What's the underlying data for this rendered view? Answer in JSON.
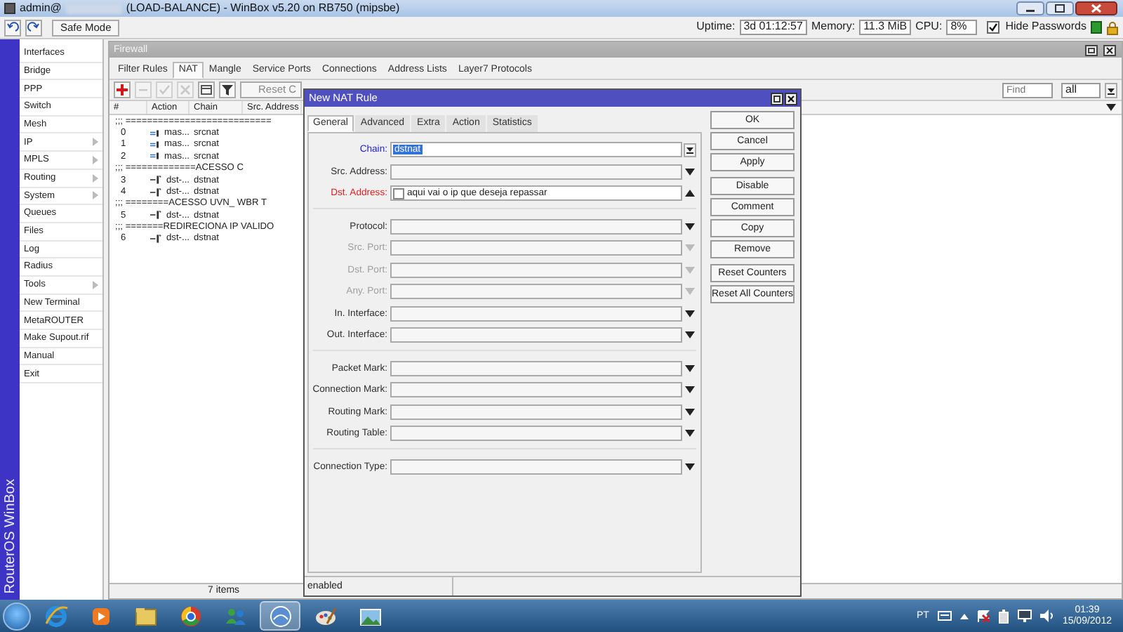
{
  "window": {
    "title_prefix": "admin@",
    "title": "(LOAD-BALANCE) - WinBox v5.20 on RB750 (mipsbe)"
  },
  "toolbar": {
    "safe_mode": {
      "label": "Safe Mode",
      "on": false
    },
    "uptime_label": "Uptime:",
    "uptime": "3d 01:12:57",
    "memory_label": "Memory:",
    "memory": "11.3 MiB",
    "cpu_label": "CPU:",
    "cpu": "8%",
    "hide_passwords": {
      "label": "Hide Passwords",
      "checked": true
    }
  },
  "side_strip": "RouterOS WinBox",
  "sidebar": {
    "items": [
      {
        "label": "Interfaces",
        "submenu": false
      },
      {
        "label": "Bridge",
        "submenu": false
      },
      {
        "label": "PPP",
        "submenu": false
      },
      {
        "label": "Switch",
        "submenu": false
      },
      {
        "label": "Mesh",
        "submenu": false
      },
      {
        "label": "IP",
        "submenu": true
      },
      {
        "label": "MPLS",
        "submenu": true
      },
      {
        "label": "Routing",
        "submenu": true
      },
      {
        "label": "System",
        "submenu": true
      },
      {
        "label": "Queues",
        "submenu": false
      },
      {
        "label": "Files",
        "submenu": false
      },
      {
        "label": "Log",
        "submenu": false
      },
      {
        "label": "Radius",
        "submenu": false
      },
      {
        "label": "Tools",
        "submenu": true
      },
      {
        "label": "New Terminal",
        "submenu": false
      },
      {
        "label": "MetaROUTER",
        "submenu": false
      },
      {
        "label": "Make Supout.rif",
        "submenu": false
      },
      {
        "label": "Manual",
        "submenu": false
      },
      {
        "label": "Exit",
        "submenu": false
      }
    ]
  },
  "firewall": {
    "title": "Firewall",
    "tabs": [
      {
        "label": "Filter Rules",
        "selected": false
      },
      {
        "label": "NAT",
        "selected": true
      },
      {
        "label": "Mangle",
        "selected": false
      },
      {
        "label": "Service Ports",
        "selected": false
      },
      {
        "label": "Connections",
        "selected": false
      },
      {
        "label": "Address Lists",
        "selected": false
      },
      {
        "label": "Layer7 Protocols",
        "selected": false
      }
    ],
    "tools": [
      {
        "kind": "add",
        "disabled": false
      },
      {
        "kind": "remove",
        "disabled": true
      },
      {
        "kind": "enable",
        "disabled": true
      },
      {
        "kind": "disable",
        "disabled": true
      },
      {
        "kind": "comment",
        "disabled": false
      },
      {
        "kind": "filter",
        "disabled": false
      }
    ],
    "reset_button": "Reset C",
    "find": {
      "placeholder": "Find"
    },
    "filter_value": "all",
    "table": {
      "columns": [
        "#",
        "Action",
        "Chain",
        "Src. Address"
      ],
      "rows": [
        {
          "kind": "comment",
          "text": ";;; ==========================="
        },
        {
          "kind": "masquerade",
          "number": "0",
          "action": "mas...",
          "chain": "srcnat"
        },
        {
          "kind": "masquerade",
          "number": "1",
          "action": "mas...",
          "chain": "srcnat"
        },
        {
          "kind": "masquerade",
          "number": "2",
          "action": "mas...",
          "chain": "srcnat"
        },
        {
          "kind": "comment",
          "text": ";;; =============ACESSO C"
        },
        {
          "kind": "dstnat",
          "number": "3",
          "action": "dst-...",
          "chain": "dstnat"
        },
        {
          "kind": "dstnat",
          "number": "4",
          "action": "dst-...",
          "chain": "dstnat"
        },
        {
          "kind": "comment",
          "text": ";;; ========ACESSO UVN_ WBR T"
        },
        {
          "kind": "dstnat",
          "number": "5",
          "action": "dst-...",
          "chain": "dstnat"
        },
        {
          "kind": "comment",
          "text": ";;; =======REDIRECIONA IP VALIDO"
        },
        {
          "kind": "dstnat",
          "number": "6",
          "action": "dst-...",
          "chain": "dstnat"
        }
      ]
    },
    "status": "7 items"
  },
  "dialog": {
    "title": "New NAT Rule",
    "tabs": [
      {
        "label": "General",
        "selected": true
      },
      {
        "label": "Advanced",
        "selected": false
      },
      {
        "label": "Extra",
        "selected": false
      },
      {
        "label": "Action",
        "selected": false
      },
      {
        "label": "Statistics",
        "selected": false
      }
    ],
    "groups": [
      [
        {
          "label": "Chain:",
          "color": "#2020d0",
          "value": "dstnat",
          "value_selected": true,
          "kind": "updown",
          "disabled": false
        },
        {
          "label": "Src. Address:",
          "color": "#303030",
          "kind": "down",
          "disabled": false
        },
        {
          "label": "Dst. Address:",
          "color": "#e02020",
          "value": "aqui vai o ip que deseja repassar",
          "value_selected": false,
          "negate": false,
          "kind": "up",
          "disabled": false
        }
      ],
      [
        {
          "label": "Protocol:",
          "color": "#303030",
          "kind": "down",
          "disabled": false
        },
        {
          "label": "Src. Port:",
          "kind": "down",
          "disabled": true
        },
        {
          "label": "Dst. Port:",
          "kind": "down",
          "disabled": true
        },
        {
          "label": "Any. Port:",
          "kind": "down",
          "disabled": true
        },
        {
          "label": "In. Interface:",
          "color": "#303030",
          "kind": "down",
          "disabled": false
        },
        {
          "label": "Out. Interface:",
          "color": "#303030",
          "kind": "down",
          "disabled": false
        }
      ],
      [
        {
          "label": "Packet Mark:",
          "color": "#303030",
          "kind": "down",
          "disabled": false
        },
        {
          "label": "Connection Mark:",
          "color": "#303030",
          "kind": "down",
          "disabled": false
        },
        {
          "label": "Routing Mark:",
          "color": "#303030",
          "kind": "down",
          "disabled": false
        },
        {
          "label": "Routing Table:",
          "color": "#303030",
          "kind": "down",
          "disabled": false
        }
      ],
      [
        {
          "label": "Connection Type:",
          "color": "#303030",
          "kind": "down",
          "disabled": false
        }
      ]
    ],
    "buttons": [
      [
        "OK",
        "Cancel",
        "Apply"
      ],
      [
        "Disable",
        "Comment",
        "Copy",
        "Remove"
      ],
      [
        "Reset Counters",
        "Reset All Counters"
      ]
    ],
    "status": "enabled"
  },
  "taskbar": {
    "apps": [
      {
        "kind": "browser-e",
        "active": false
      },
      {
        "kind": "media",
        "active": false
      },
      {
        "kind": "folder",
        "active": false
      },
      {
        "kind": "browser-round",
        "active": false
      },
      {
        "kind": "people",
        "active": false
      },
      {
        "kind": "winbox",
        "active": true
      },
      {
        "kind": "paint",
        "active": false
      },
      {
        "kind": "photo",
        "active": false
      }
    ],
    "language": "PT",
    "time": "01:39",
    "date": "15/09/2012"
  }
}
